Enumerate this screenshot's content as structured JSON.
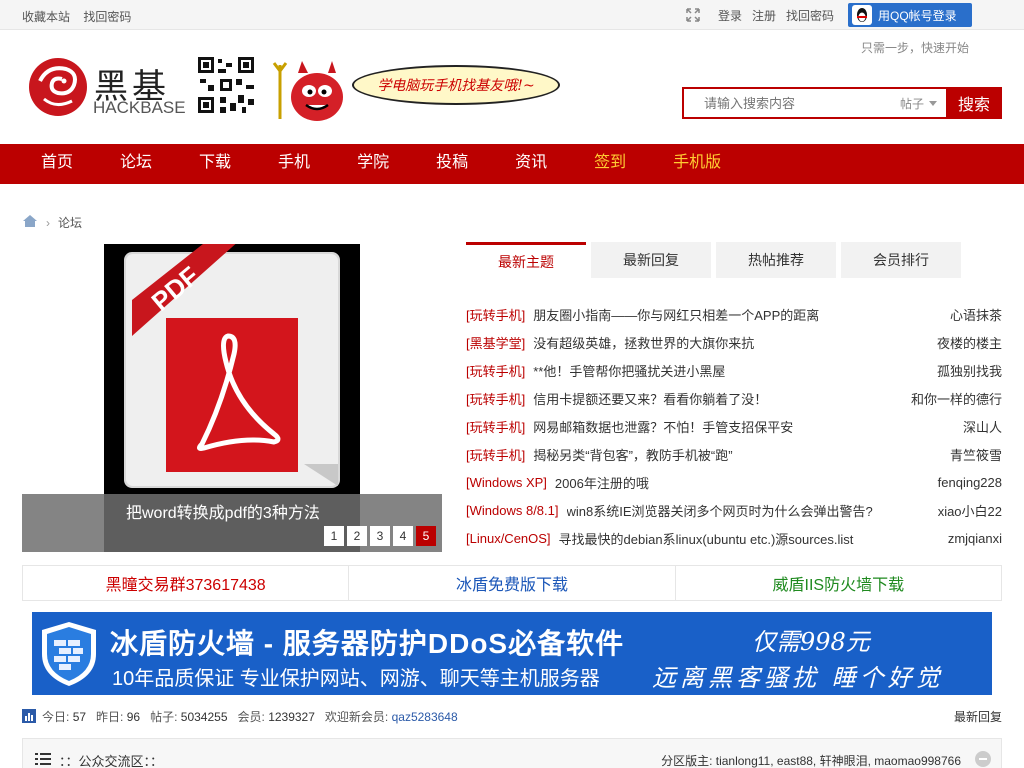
{
  "topbar": {
    "left_links": [
      "收藏本站",
      "找回密码"
    ],
    "right_links": [
      "登录",
      "注册",
      "找回密码"
    ],
    "qq_login": "用QQ帐号登录"
  },
  "header": {
    "logo_cn": "黑基",
    "logo_en": "HACKBASE",
    "slogan": "学电脑玩手机找基友哦!~",
    "hint": "只需一步，快速开始",
    "search_placeholder": "请输入搜索内容",
    "search_type": "帖子",
    "search_button": "搜索"
  },
  "nav": {
    "items": [
      {
        "label": "首页",
        "highlight": false
      },
      {
        "label": "论坛",
        "highlight": false
      },
      {
        "label": "下载",
        "highlight": false
      },
      {
        "label": "手机",
        "highlight": false
      },
      {
        "label": "学院",
        "highlight": false
      },
      {
        "label": "投稿",
        "highlight": false
      },
      {
        "label": "资讯",
        "highlight": false
      },
      {
        "label": "签到",
        "highlight": true
      },
      {
        "label": "手机版",
        "highlight": true
      }
    ]
  },
  "breadcrumb": {
    "current": "论坛"
  },
  "slider": {
    "caption": "把word转换成pdf的3种方法",
    "pages": [
      "1",
      "2",
      "3",
      "4",
      "5"
    ],
    "active_page": "5"
  },
  "tabs": [
    "最新主题",
    "最新回复",
    "热帖推荐",
    "会员排行"
  ],
  "threads": [
    {
      "cat": "[玩转手机]",
      "title": "朋友圈小指南——你与网红只相差一个APP的距离",
      "author": "心语抹茶"
    },
    {
      "cat": "[黑基学堂]",
      "title": "没有超级英雄，拯救世界的大旗你来抗",
      "author": "夜楼的楼主"
    },
    {
      "cat": "[玩转手机]",
      "title": "**他！手管帮你把骚扰关进小黑屋",
      "author": "孤独别找我"
    },
    {
      "cat": "[玩转手机]",
      "title": "信用卡提额还要又来？看看你躺着了没！",
      "author": "和你一样的德行"
    },
    {
      "cat": "[玩转手机]",
      "title": "网易邮箱数据也泄露？不怕！手管支招保平安",
      "author": "深山人"
    },
    {
      "cat": "[玩转手机]",
      "title": "揭秘另类“背包客”，教防手机被“跑”",
      "author": "青竺筱雪"
    },
    {
      "cat": "[Windows XP]",
      "title": "2006年注册的哦",
      "author": "fenqing228"
    },
    {
      "cat": "[Windows 8/8.1]",
      "title": "win8系统IE浏览器关闭多个网页时为什么会弹出警告?",
      "author": "xiao小白22"
    },
    {
      "cat": "[Linux/CenOS]",
      "title": "寻找最快的debian系linux(ubuntu etc.)源sources.list",
      "author": "zmjqianxi"
    }
  ],
  "links": [
    {
      "text": "黑曈交易群373617438",
      "color": "#cc0000"
    },
    {
      "text": "冰盾免费版下载",
      "color": "#1a56b8"
    },
    {
      "text": "威盾IIS防火墙下载",
      "color": "#1f8a1f"
    }
  ],
  "banner": {
    "title": "冰盾防火墙 - 服务器防护DDoS必备软件",
    "subtitle": "10年品质保证 专业保护网站、网游、聊天等主机服务器",
    "price": "仅需998元",
    "tagline": "远离黑客骚扰 睡个好觉"
  },
  "stats": {
    "today_label": "今日:",
    "today": "57",
    "yesterday_label": "昨日:",
    "yesterday": "96",
    "posts_label": "帖子:",
    "posts": "5034255",
    "members_label": "会员:",
    "members": "1239327",
    "welcome_label": "欢迎新会员:",
    "newest": "qaz5283648",
    "latest_reply": "最新回复"
  },
  "section": {
    "title": "：：公众交流区：：",
    "moderators": "分区版主: tianlong11, east88, 轩神眼泪, maomao998766"
  },
  "colors": {
    "brand": "#bb0000",
    "nav_highlight": "#ffcc33",
    "qq_blue": "#2a6fcb",
    "banner_blue": "#1960c8"
  }
}
